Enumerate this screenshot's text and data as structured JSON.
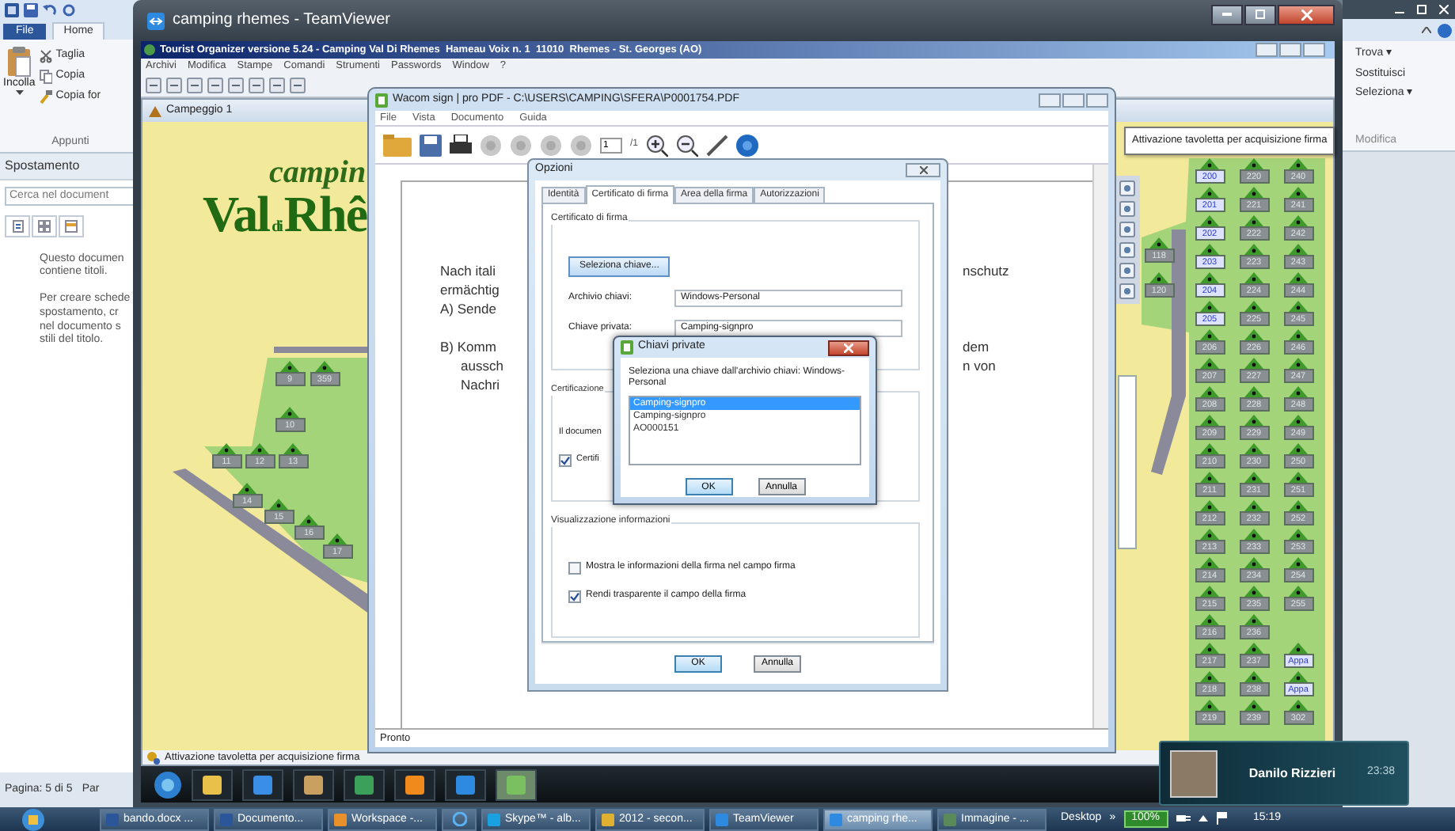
{
  "word": {
    "tabs": [
      {
        "label": "File",
        "kind": "backstage",
        "selected": false
      },
      {
        "label": "Home",
        "kind": "tab",
        "selected": true
      }
    ],
    "clipboard": {
      "paste": "Incolla",
      "items": [
        "Taglia",
        "Copia",
        "Copia for"
      ],
      "group": "Appunti"
    },
    "nav_pane": {
      "title": "Spostamento",
      "search_placeholder": "Cerca nel document",
      "messages": [
        [
          "Questo documen",
          "contiene titoli."
        ],
        [
          "Per creare schede",
          "spostamento, cr",
          "nel documento s",
          "stili del titolo."
        ]
      ]
    },
    "editing": {
      "items": [
        "Trova ▾",
        "Sostituisci",
        "Seleziona ▾"
      ],
      "group": "Modifica"
    },
    "status_bar": [
      "Pagina: 5 di 5",
      "Par"
    ]
  },
  "teamviewer": {
    "title": "camping rhemes - TeamViewer",
    "app_title": "Tourist Organizer versione 5.24 - Camping Val Di Rhemes  Hameau Voix n. 1  11010  Rhemes - St. Georges (AO)",
    "menu": [
      "Archivi",
      "Modifica",
      "Stampe",
      "Comandi",
      "Strumenti",
      "Passwords",
      "Window",
      "?"
    ],
    "child_title": "Campeggio 1",
    "logo": {
      "script_text": "campin",
      "name_left": "Val",
      "name_small": "di",
      "name_right": "Rhê"
    },
    "sites_left": [
      {
        "label": "9",
        "highlighted": false
      },
      {
        "label": "359",
        "highlighted": false
      },
      {
        "label": "10",
        "highlighted": false
      },
      {
        "label": "11",
        "highlighted": false
      },
      {
        "label": "12",
        "highlighted": false
      },
      {
        "label": "13",
        "highlighted": false
      },
      {
        "label": "14",
        "highlighted": false
      },
      {
        "label": "15",
        "highlighted": false
      },
      {
        "label": "16",
        "highlighted": false
      },
      {
        "label": "17",
        "highlighted": false
      }
    ],
    "sites_mid": [
      {
        "label": "118",
        "highlighted": false
      },
      {
        "label": "120",
        "highlighted": false
      }
    ],
    "sites_grid": [
      {
        "cells": [
          {
            "label": "200",
            "highlighted": true
          },
          {
            "label": "220",
            "highlighted": false
          },
          {
            "label": "240",
            "highlighted": false
          }
        ]
      },
      {
        "cells": [
          {
            "label": "201",
            "highlighted": true
          },
          {
            "label": "221",
            "highlighted": false
          },
          {
            "label": "241",
            "highlighted": false
          }
        ]
      },
      {
        "cells": [
          {
            "label": "202",
            "highlighted": true
          },
          {
            "label": "222",
            "highlighted": false
          },
          {
            "label": "242",
            "highlighted": false
          }
        ]
      },
      {
        "cells": [
          {
            "label": "203",
            "highlighted": true
          },
          {
            "label": "223",
            "highlighted": false
          },
          {
            "label": "243",
            "highlighted": false
          }
        ]
      },
      {
        "cells": [
          {
            "label": "204",
            "highlighted": true
          },
          {
            "label": "224",
            "highlighted": false
          },
          {
            "label": "244",
            "highlighted": false
          }
        ]
      },
      {
        "cells": [
          {
            "label": "205",
            "highlighted": true
          },
          {
            "label": "225",
            "highlighted": false
          },
          {
            "label": "245",
            "highlighted": false
          }
        ]
      },
      {
        "cells": [
          {
            "label": "206",
            "highlighted": false
          },
          {
            "label": "226",
            "highlighted": false
          },
          {
            "label": "246",
            "highlighted": false
          }
        ]
      },
      {
        "cells": [
          {
            "label": "207",
            "highlighted": false
          },
          {
            "label": "227",
            "highlighted": false
          },
          {
            "label": "247",
            "highlighted": false
          }
        ]
      },
      {
        "cells": [
          {
            "label": "208",
            "highlighted": false
          },
          {
            "label": "228",
            "highlighted": false
          },
          {
            "label": "248",
            "highlighted": false
          }
        ]
      },
      {
        "cells": [
          {
            "label": "209",
            "highlighted": false
          },
          {
            "label": "229",
            "highlighted": false
          },
          {
            "label": "249",
            "highlighted": false
          }
        ]
      },
      {
        "cells": [
          {
            "label": "210",
            "highlighted": false
          },
          {
            "label": "230",
            "highlighted": false
          },
          {
            "label": "250",
            "highlighted": false
          }
        ]
      },
      {
        "cells": [
          {
            "label": "211",
            "highlighted": false
          },
          {
            "label": "231",
            "highlighted": false
          },
          {
            "label": "251",
            "highlighted": false
          }
        ]
      },
      {
        "cells": [
          {
            "label": "212",
            "highlighted": false
          },
          {
            "label": "232",
            "highlighted": false
          },
          {
            "label": "252",
            "highlighted": false
          }
        ]
      },
      {
        "cells": [
          {
            "label": "213",
            "highlighted": false
          },
          {
            "label": "233",
            "highlighted": false
          },
          {
            "label": "253",
            "highlighted": false
          }
        ]
      },
      {
        "cells": [
          {
            "label": "214",
            "highlighted": false
          },
          {
            "label": "234",
            "highlighted": false
          },
          {
            "label": "254",
            "highlighted": false
          }
        ]
      },
      {
        "cells": [
          {
            "label": "215",
            "highlighted": false
          },
          {
            "label": "235",
            "highlighted": false
          },
          {
            "label": "255",
            "highlighted": false
          }
        ]
      },
      {
        "cells": [
          {
            "label": "216",
            "highlighted": false
          },
          {
            "label": "236",
            "highlighted": false
          }
        ]
      },
      {
        "cells": [
          {
            "label": "217",
            "highlighted": false
          },
          {
            "label": "237",
            "highlighted": false
          },
          {
            "label": "Appa",
            "highlighted": true
          }
        ]
      },
      {
        "cells": [
          {
            "label": "218",
            "highlighted": false
          },
          {
            "label": "238",
            "highlighted": false
          },
          {
            "label": "Appa",
            "highlighted": true
          }
        ]
      },
      {
        "cells": [
          {
            "label": "219",
            "highlighted": false
          },
          {
            "label": "239",
            "highlighted": false
          },
          {
            "label": "302",
            "highlighted": false
          }
        ]
      }
    ],
    "tooltip": "Attivazione tavoletta per acquisizione firma",
    "status": "Attivazione tavoletta per acquisizione firma"
  },
  "wacom": {
    "title": "Wacom sign | pro PDF - C:\\USERS\\CAMPING\\SFERA\\P0001754.PDF",
    "menu": [
      "File",
      "Vista",
      "Documento",
      "Guida"
    ],
    "page": "1",
    "page_count": "/1",
    "document": {
      "paragraph": [
        {
          "left": "Nach itali",
          "right": "nschutz"
        },
        {
          "left": "ermächtig"
        }
      ],
      "list": [
        {
          "lines": [
            {
              "left": "A) Sende"
            }
          ]
        },
        {
          "lines": [
            {
              "left": "B) Komm",
              "right": "dem"
            },
            {
              "left": "aussch",
              "right": "n von"
            },
            {
              "left": "Nachri"
            }
          ]
        }
      ]
    },
    "status": "Pronto"
  },
  "options": {
    "title": "Opzioni",
    "tabs": [
      {
        "label": "Identità",
        "selected": false
      },
      {
        "label": "Certificato di firma",
        "selected": true
      },
      {
        "label": "Area della firma",
        "selected": false
      },
      {
        "label": "Autorizzazioni",
        "selected": false
      }
    ],
    "certificate": {
      "legend": "Certificato di firma",
      "select_button": "Seleziona chiave...",
      "fields": [
        {
          "label": "Archivio chiavi:",
          "value": "Windows-Personal"
        },
        {
          "label": "Chiave privata:",
          "value": "Camping-signpro"
        }
      ]
    },
    "certification": {
      "legend": "Certificazione",
      "text": "Il documen",
      "checkbox": {
        "label": "Certifi",
        "checked": true
      }
    },
    "display": {
      "legend": "Visualizzazione informazioni",
      "checkboxes": [
        {
          "label": "Mostra le informazioni della firma nel campo firma",
          "checked": false
        },
        {
          "label": "Rendi trasparente il campo della firma",
          "checked": true
        }
      ]
    },
    "buttons": [
      "OK",
      "Annulla"
    ]
  },
  "keys_dialog": {
    "title": "Chiavi private",
    "prompt": "Seleziona una chiave dall'archivio chiavi: Windows-Personal",
    "items": [
      {
        "label": "Camping-signpro",
        "selected": true
      },
      {
        "label": "Camping-signpro",
        "selected": false
      },
      {
        "label": "AO000151",
        "selected": false
      }
    ],
    "buttons": [
      "OK",
      "Annulla"
    ]
  },
  "chat_notification": {
    "name": "Danilo Rizzieri",
    "time": "23:38"
  },
  "taskbar": {
    "items": [
      {
        "kind": "labeled",
        "label": "bando.docx ...",
        "selected": false
      },
      {
        "kind": "labeled",
        "label": "Documento...",
        "selected": false
      },
      {
        "kind": "labeled",
        "label": "Workspace -...",
        "selected": false
      },
      {
        "kind": "icon_only",
        "selected": false
      },
      {
        "kind": "labeled",
        "label": "Skype™ - alb...",
        "selected": false
      },
      {
        "kind": "labeled",
        "label": "2012 - secon...",
        "selected": false
      },
      {
        "kind": "labeled",
        "label": "TeamViewer",
        "selected": false
      },
      {
        "kind": "labeled",
        "label": "camping rhe...",
        "selected": true
      },
      {
        "kind": "labeled",
        "label": "Immagine - ...",
        "selected": false
      }
    ],
    "toolbar": "Desktop",
    "chevron": "»",
    "battery": "100%",
    "clock": "15:19"
  }
}
